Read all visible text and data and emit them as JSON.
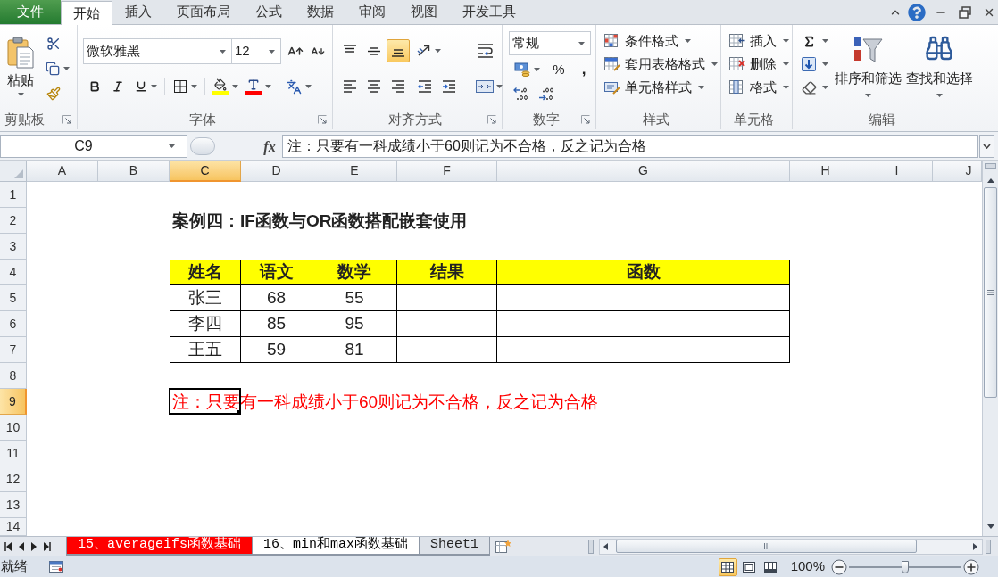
{
  "menu_tabs": [
    {
      "label": "文件",
      "kind": "file",
      "selected": false
    },
    {
      "label": "开始",
      "kind": "tab",
      "selected": true
    },
    {
      "label": "插入",
      "kind": "tab",
      "selected": false
    },
    {
      "label": "页面布局",
      "kind": "tab",
      "selected": false
    },
    {
      "label": "公式",
      "kind": "tab",
      "selected": false
    },
    {
      "label": "数据",
      "kind": "tab",
      "selected": false
    },
    {
      "label": "审阅",
      "kind": "tab",
      "selected": false
    },
    {
      "label": "视图",
      "kind": "tab",
      "selected": false
    },
    {
      "label": "开发工具",
      "kind": "tab",
      "selected": false
    }
  ],
  "ribbon": {
    "clipboard": {
      "paste": "粘贴",
      "label": "剪贴板"
    },
    "font": {
      "font_name": "微软雅黑",
      "font_size": "12",
      "label": "字体"
    },
    "alignment": {
      "vertical": [
        {
          "kind": "top",
          "selected": false
        },
        {
          "kind": "middle",
          "selected": false
        },
        {
          "kind": "bottom",
          "selected": true
        }
      ],
      "label": "对齐方式"
    },
    "number": {
      "format": "常规",
      "percent": "%",
      "comma": ",",
      "label": "数字"
    },
    "styles": {
      "items": [
        {
          "kind": "conditional",
          "label": "条件格式"
        },
        {
          "kind": "table",
          "label": "套用表格格式"
        },
        {
          "kind": "cell",
          "label": "单元格样式"
        }
      ],
      "label": "样式"
    },
    "cells": {
      "items": [
        {
          "kind": "insert",
          "label": "插入"
        },
        {
          "kind": "delete",
          "label": "删除"
        },
        {
          "kind": "format",
          "label": "格式"
        }
      ],
      "label": "单元格"
    },
    "editing": {
      "sort_filter": "排序和筛选",
      "find_select": "查找和选择",
      "label": "编辑"
    }
  },
  "formula_bar": {
    "name_box": "C9",
    "function_button": "fx",
    "formula": "注：只要有一科成绩小于60则记为不合格，反之记为合格"
  },
  "sheet": {
    "columns": [
      {
        "label": "A",
        "selected": false
      },
      {
        "label": "B",
        "selected": false
      },
      {
        "label": "C",
        "selected": true
      },
      {
        "label": "D",
        "selected": false
      },
      {
        "label": "E",
        "selected": false
      },
      {
        "label": "F",
        "selected": false
      },
      {
        "label": "G",
        "selected": false
      },
      {
        "label": "H",
        "selected": false
      },
      {
        "label": "I",
        "selected": false
      },
      {
        "label": "J",
        "selected": false
      }
    ],
    "rows": [
      {
        "label": "1",
        "selected": false
      },
      {
        "label": "2",
        "selected": false
      },
      {
        "label": "3",
        "selected": false
      },
      {
        "label": "4",
        "selected": false
      },
      {
        "label": "5",
        "selected": false
      },
      {
        "label": "6",
        "selected": false
      },
      {
        "label": "7",
        "selected": false
      },
      {
        "label": "8",
        "selected": false
      },
      {
        "label": "9",
        "selected": true
      },
      {
        "label": "10",
        "selected": false
      },
      {
        "label": "11",
        "selected": false
      },
      {
        "label": "12",
        "selected": false
      },
      {
        "label": "13",
        "selected": false
      },
      {
        "label": "14",
        "selected": false
      }
    ],
    "title": "案例四：IF函数与OR函数搭配嵌套使用",
    "table": {
      "header": [
        "姓名",
        "语文",
        "数学",
        "结果",
        "函数"
      ],
      "rows": [
        [
          "张三",
          "68",
          "55"
        ],
        [
          "李四",
          "85",
          "95"
        ],
        [
          "王五",
          "59",
          "81"
        ]
      ]
    },
    "note": "注：只要有一科成绩小于60则记为不合格，反之记为合格"
  },
  "sheet_tabs": [
    {
      "label": "15、averageifs函数基础",
      "color": "#ff0000",
      "selected": false
    },
    {
      "label": "16、min和max函数基础",
      "selected": true
    },
    {
      "label": "Sheet1",
      "selected": false
    }
  ],
  "status_bar": {
    "status": "就绪",
    "views": [
      {
        "kind": "normal",
        "selected": true
      },
      {
        "kind": "page_layout",
        "selected": false
      },
      {
        "kind": "page_break",
        "selected": false
      }
    ],
    "zoom": "100%",
    "zoom_slider": {
      "level": 0.5
    }
  }
}
